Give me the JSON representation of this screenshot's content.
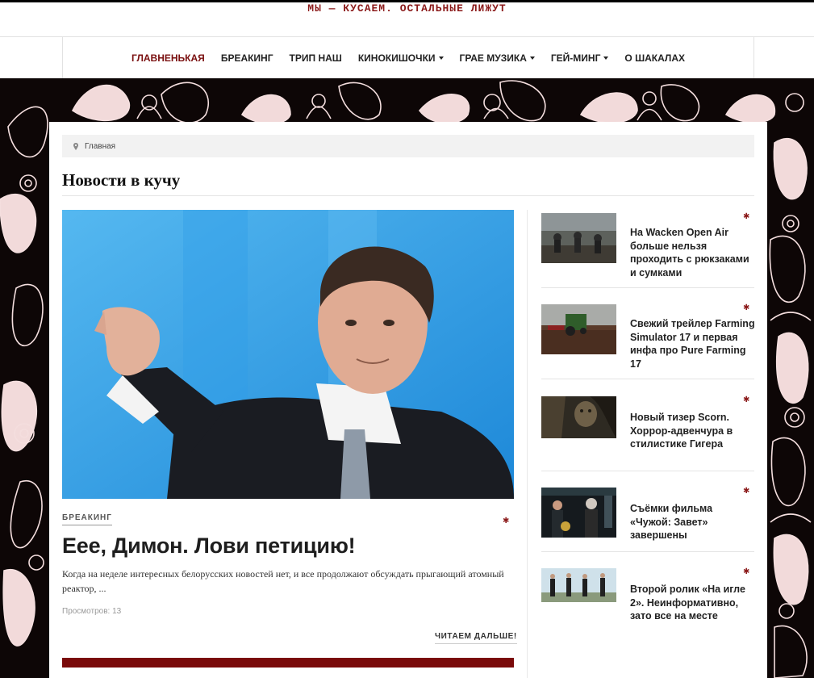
{
  "header": {
    "tagline": "МЫ — КУСАЕМ. ОСТАЛЬНЫЕ ЛИЖУТ"
  },
  "nav": {
    "items": [
      {
        "label": "ГЛАВНЕНЬКАЯ",
        "active": true,
        "dropdown": false
      },
      {
        "label": "БРЕАКИНГ",
        "active": false,
        "dropdown": false
      },
      {
        "label": "ТРИП НАШ",
        "active": false,
        "dropdown": false
      },
      {
        "label": "КИНОКИШОЧКИ",
        "active": false,
        "dropdown": true
      },
      {
        "label": "ГРАЕ МУЗИКА",
        "active": false,
        "dropdown": true
      },
      {
        "label": "ГЕЙ-МИНГ",
        "active": false,
        "dropdown": true
      },
      {
        "label": "О ШАКАЛАХ",
        "active": false,
        "dropdown": false
      }
    ]
  },
  "breadcrumb": {
    "home": "Главная"
  },
  "page": {
    "title": "Новости в кучу"
  },
  "feature": {
    "category": "БРЕАКИНГ",
    "title": "Еее, Димон. Лови петицию!",
    "excerpt": "Когда на неделе интересных белорусских новостей нет, и все продолжают обсуждать прыгающий атомный реактор, ...",
    "views": "Просмотров: 13",
    "read_more": "ЧИТАЕМ ДАЛЬШЕ!"
  },
  "sidebar": {
    "posts": [
      {
        "title": "На Wacken Open Air больше нельзя проходить с рюкзаками и сумками"
      },
      {
        "title": "Свежий трейлер Farming Simulator 17 и первая инфа про Pure Farming 17"
      },
      {
        "title": "Новый тизер Scorn. Хоррор-адвенчура в стилистике Гигера"
      },
      {
        "title": "Съёмки фильма «Чужой: Завет» завершены"
      },
      {
        "title": "Второй ролик «На игле 2». Неинформативно, зато все на месте"
      }
    ]
  },
  "colors": {
    "accent": "#7a1010",
    "bar": "#7a0a0a",
    "background": "#0d0606"
  },
  "icons": {
    "breadcrumb": "map-pin-icon",
    "post_meta": "gear-icon",
    "dropdown": "caret-down-icon"
  }
}
